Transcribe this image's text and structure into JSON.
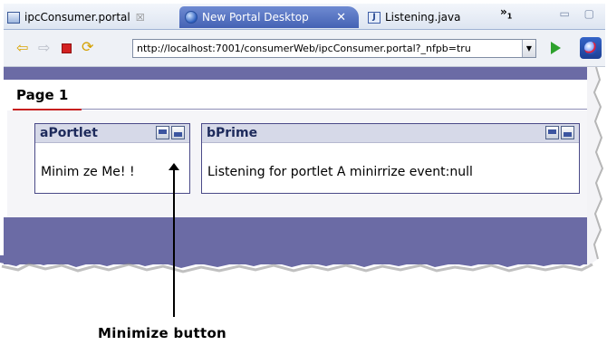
{
  "tabs": [
    {
      "label": "ipcConsumer.portal",
      "close": "☒",
      "icon": "portal-file-icon"
    },
    {
      "label": "New Portal Desktop",
      "close": "✕",
      "icon": "browser-globe-icon"
    },
    {
      "label": "Listening.java",
      "icon": "java-file-icon"
    }
  ],
  "tab_overflow": {
    "label": "»",
    "count": "1"
  },
  "window_controls": {
    "label": "▭ ▢"
  },
  "toolbar": {
    "url": "nttp://localhost:7001/consumerWeb/ipcConsumer.portal?_nfpb=tru",
    "icons": [
      "back-arrow-icon",
      "forward-arrow-icon",
      "stop-icon",
      "refresh-icon",
      "go-icon",
      "web-browser-icon"
    ]
  },
  "portal": {
    "page_tab": "Page 1",
    "portlets": [
      {
        "title": "aPortlet",
        "body": "Minim ze Me! !"
      },
      {
        "title": "bPrime",
        "body": "Listening for portlet A minirrize event:null"
      }
    ]
  },
  "callout": {
    "label": "Minimize button"
  },
  "colors": {
    "accent_band": "#6b6ba5",
    "active_tab": "#4462b4",
    "page_underline": "#c71f1f"
  }
}
